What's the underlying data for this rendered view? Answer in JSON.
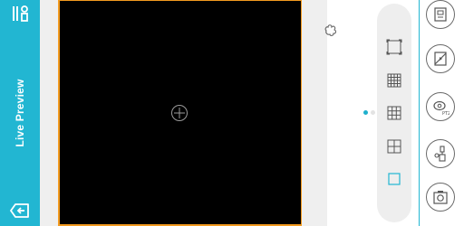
{
  "app": {
    "title": "Live Preview"
  },
  "sidebar": {
    "menu_icon": "camera-list-icon",
    "back_icon": "exit-icon"
  },
  "video": {
    "add_channel_icon": "add-channel-icon",
    "selected_border_color": "#f29a1f"
  },
  "layouts": [
    {
      "name": "layout-fullscreen-icon"
    },
    {
      "name": "layout-16-grid-icon"
    },
    {
      "name": "layout-9-grid-icon"
    },
    {
      "name": "layout-4-grid-icon"
    },
    {
      "name": "layout-single-icon",
      "selected": true
    }
  ],
  "actions": [
    {
      "name": "record-icon"
    },
    {
      "name": "snapshot-off-icon"
    },
    {
      "name": "ptz-icon"
    },
    {
      "name": "talk-icon"
    },
    {
      "name": "capture-icon"
    }
  ],
  "colors": {
    "accent": "#22b6d2",
    "video_bg": "#000000",
    "panel_bg": "#efefef"
  }
}
